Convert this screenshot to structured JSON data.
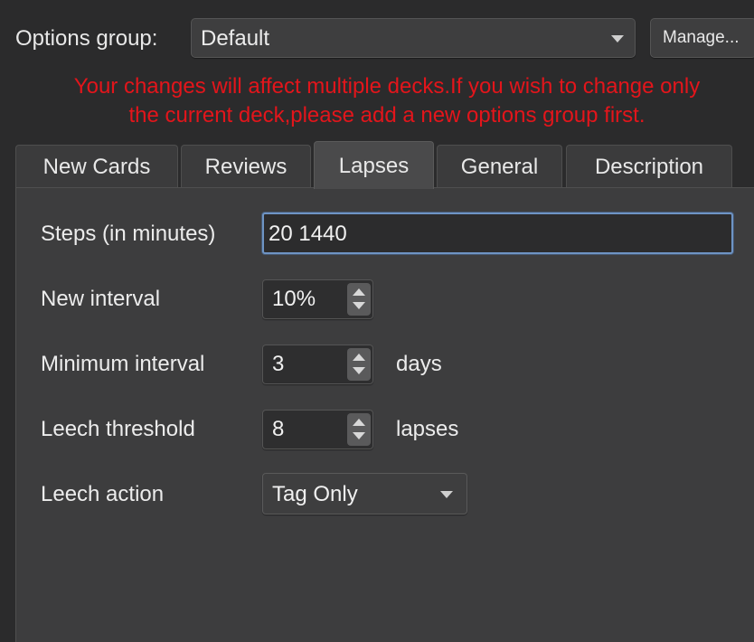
{
  "options_group": {
    "label": "Options group:",
    "selected": "Default",
    "manage_label": "Manage..."
  },
  "warning": {
    "line1": "Your changes will affect multiple decks.If you wish to change only",
    "line2": "the current deck,please add a new options group first."
  },
  "tabs": [
    {
      "label": "New Cards",
      "active": false
    },
    {
      "label": "Reviews",
      "active": false
    },
    {
      "label": "Lapses",
      "active": true
    },
    {
      "label": "General",
      "active": false
    },
    {
      "label": "Description",
      "active": false
    }
  ],
  "lapses": {
    "steps": {
      "label": "Steps (in minutes)",
      "value": "20 1440"
    },
    "new_interval": {
      "label": "New interval",
      "value": "10%"
    },
    "minimum_interval": {
      "label": "Minimum interval",
      "value": "3",
      "unit": "days"
    },
    "leech_threshold": {
      "label": "Leech threshold",
      "value": "8",
      "unit": "lapses"
    },
    "leech_action": {
      "label": "Leech action",
      "value": "Tag Only"
    }
  },
  "colors": {
    "background": "#2b2b2c",
    "panel": "#3d3d3e",
    "warning": "#e3151b",
    "focus_ring": "#6e94c4"
  }
}
